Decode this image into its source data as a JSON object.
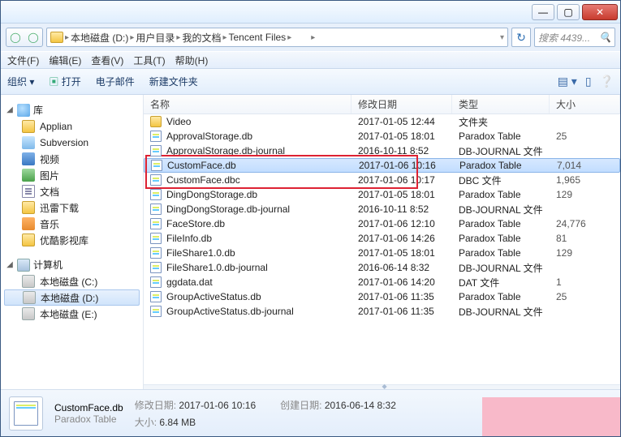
{
  "breadcrumbs": [
    "本地磁盘 (D:)",
    "用户目录",
    "我的文档",
    "Tencent Files"
  ],
  "search_placeholder": "搜索 4439...",
  "menu": {
    "file": "文件(F)",
    "edit": "编辑(E)",
    "view": "查看(V)",
    "tools": "工具(T)",
    "help": "帮助(H)"
  },
  "toolbar": {
    "organize": "组织 ▾",
    "open": "打开",
    "email": "电子邮件",
    "newfolder": "新建文件夹"
  },
  "sidebar": {
    "library": {
      "label": "库",
      "items": [
        "Applian",
        "Subversion",
        "视频",
        "图片",
        "文档",
        "迅雷下载",
        "音乐",
        "优酷影视库"
      ]
    },
    "computer": {
      "label": "计算机",
      "items": [
        "本地磁盘 (C:)",
        "本地磁盘 (D:)",
        "本地磁盘 (E:)"
      ]
    }
  },
  "columns": {
    "name": "名称",
    "date": "修改日期",
    "type": "类型",
    "size": "大小"
  },
  "files": [
    {
      "name": "Video",
      "date": "2017-01-05 12:44",
      "type": "文件夹",
      "size": "",
      "icon": "fi-fold"
    },
    {
      "name": "ApprovalStorage.db",
      "date": "2017-01-05 18:01",
      "type": "Paradox Table",
      "size": "25",
      "icon": "fi-db"
    },
    {
      "name": "ApprovalStorage.db-journal",
      "date": "2016-10-11 8:52",
      "type": "DB-JOURNAL 文件",
      "size": "",
      "icon": "fi-db"
    },
    {
      "name": "CustomFace.db",
      "date": "2017-01-06 10:16",
      "type": "Paradox Table",
      "size": "7,014",
      "icon": "fi-db",
      "sel": true
    },
    {
      "name": "CustomFace.dbc",
      "date": "2017-01-06 10:17",
      "type": "DBC 文件",
      "size": "1,965",
      "icon": "fi-db"
    },
    {
      "name": "DingDongStorage.db",
      "date": "2017-01-05 18:01",
      "type": "Paradox Table",
      "size": "129",
      "icon": "fi-db"
    },
    {
      "name": "DingDongStorage.db-journal",
      "date": "2016-10-11 8:52",
      "type": "DB-JOURNAL 文件",
      "size": "",
      "icon": "fi-db"
    },
    {
      "name": "FaceStore.db",
      "date": "2017-01-06 12:10",
      "type": "Paradox Table",
      "size": "24,776",
      "icon": "fi-db"
    },
    {
      "name": "FileInfo.db",
      "date": "2017-01-06 14:26",
      "type": "Paradox Table",
      "size": "81",
      "icon": "fi-db"
    },
    {
      "name": "FileShare1.0.db",
      "date": "2017-01-05 18:01",
      "type": "Paradox Table",
      "size": "129",
      "icon": "fi-db"
    },
    {
      "name": "FileShare1.0.db-journal",
      "date": "2016-06-14 8:32",
      "type": "DB-JOURNAL 文件",
      "size": "",
      "icon": "fi-db"
    },
    {
      "name": "ggdata.dat",
      "date": "2017-01-06 14:20",
      "type": "DAT 文件",
      "size": "1",
      "icon": "fi-db"
    },
    {
      "name": "GroupActiveStatus.db",
      "date": "2017-01-06 11:35",
      "type": "Paradox Table",
      "size": "25",
      "icon": "fi-db"
    },
    {
      "name": "GroupActiveStatus.db-journal",
      "date": "2017-01-06 11:35",
      "type": "DB-JOURNAL 文件",
      "size": "",
      "icon": "fi-db"
    }
  ],
  "details": {
    "filename": "CustomFace.db",
    "filetype": "Paradox Table",
    "mod_label": "修改日期:",
    "mod_val": "2017-01-06 10:16",
    "size_label": "大小:",
    "size_val": "6.84 MB",
    "create_label": "创建日期:",
    "create_val": "2016-06-14 8:32"
  }
}
